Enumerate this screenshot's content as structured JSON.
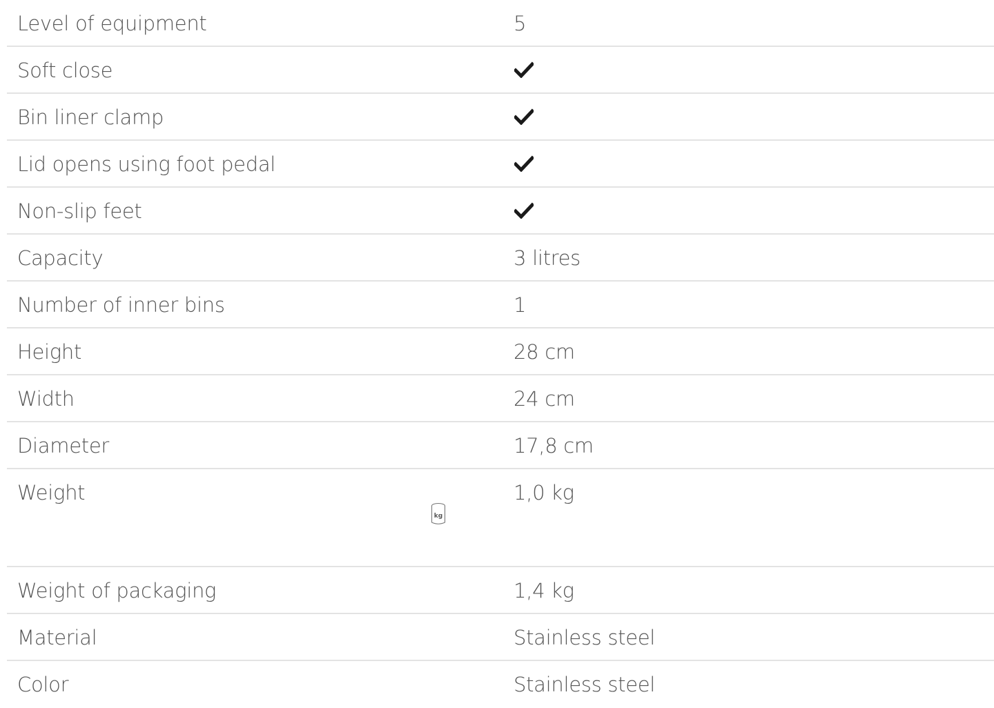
{
  "specs": [
    {
      "label": "Level of equipment",
      "value": "5"
    },
    {
      "label": "Soft close",
      "value": null,
      "icon": "check-icon"
    },
    {
      "label": "Bin liner clamp",
      "value": null,
      "icon": "check-icon"
    },
    {
      "label": "Lid opens using foot pedal",
      "value": null,
      "icon": "check-icon"
    },
    {
      "label": "Non-slip feet",
      "value": null,
      "icon": "check-icon"
    },
    {
      "label": "Capacity",
      "value": "3 litres"
    },
    {
      "label": "Number of inner bins",
      "value": "1"
    },
    {
      "label": "Height",
      "value": "28 cm"
    },
    {
      "label": "Width",
      "value": "24 cm"
    },
    {
      "label": "Diameter",
      "value": "17,8 cm"
    },
    {
      "label": "Weight",
      "value": "1,0 kg",
      "icon": "kg-weight-icon",
      "icon_text": "kg"
    },
    {
      "label": "Weight of packaging",
      "value": "1,4 kg"
    },
    {
      "label": "Material",
      "value": "Stainless steel"
    },
    {
      "label": "Color",
      "value": "Stainless steel"
    }
  ],
  "colors": {
    "text": "#555555",
    "divider": "#e3e3e3",
    "check": "#1a1a1a"
  }
}
